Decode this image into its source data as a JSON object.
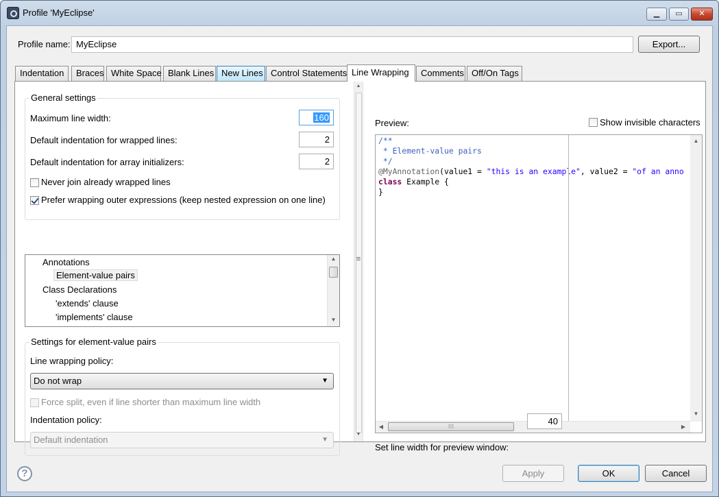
{
  "window": {
    "title": "Profile 'MyEclipse'",
    "minimize_glyph": "▁",
    "maximize_glyph": "▭",
    "close_glyph": "✕"
  },
  "profile": {
    "name_label": "Profile name:",
    "name_value": "MyEclipse",
    "export_label": "Export..."
  },
  "tabs": [
    {
      "label": "Indentation"
    },
    {
      "label": "Braces"
    },
    {
      "label": "White Space"
    },
    {
      "label": "Blank Lines"
    },
    {
      "label": "New Lines"
    },
    {
      "label": "Control Statements"
    },
    {
      "label": "Line Wrapping"
    },
    {
      "label": "Comments"
    },
    {
      "label": "Off/On Tags"
    }
  ],
  "active_tab": "Line Wrapping",
  "general": {
    "title": "General settings",
    "max_width_label": "Maximum line width:",
    "max_width_value": "160",
    "wrapped_indent_label": "Default indentation for wrapped lines:",
    "wrapped_indent_value": "2",
    "array_indent_label": "Default indentation for array initializers:",
    "array_indent_value": "2",
    "never_join_label": "Never join already wrapped lines",
    "never_join_checked": false,
    "prefer_outer_label": "Prefer wrapping outer expressions (keep nested expression on one line)",
    "prefer_outer_checked": true
  },
  "tree": {
    "items": [
      {
        "label": "Annotations"
      },
      {
        "label": "Element-value pairs"
      },
      {
        "label": "Class Declarations"
      },
      {
        "label": "'extends' clause"
      },
      {
        "label": "'implements' clause"
      }
    ],
    "selected": "Element-value pairs"
  },
  "settings": {
    "title": "Settings for element-value pairs",
    "policy_label": "Line wrapping policy:",
    "policy_value": "Do not wrap",
    "force_split_label": "Force split, even if line shorter than maximum line width",
    "force_split_checked": false,
    "indent_policy_label": "Indentation policy:",
    "indent_policy_value": "Default indentation"
  },
  "preview": {
    "label": "Preview:",
    "show_invisible_label": "Show invisible characters",
    "show_invisible_checked": false,
    "code": {
      "l1": "/**",
      "l2": " * Element-value pairs",
      "l3": " */",
      "l4_ann": "@MyAnnotation",
      "l4_mid": "(value1 = ",
      "l4_str1": "\"this is an example\"",
      "l4_mid2": ", value2 = ",
      "l4_str2": "\"of an anno",
      "l5_kw": "class",
      "l5_rest": " Example {",
      "l6": "}"
    },
    "hscroll_grip": "⁝⁝⁝",
    "width_label": "Set line width for preview window:",
    "width_value": "40"
  },
  "footer": {
    "help_glyph": "?",
    "apply_label": "Apply",
    "ok_label": "OK",
    "cancel_label": "Cancel"
  },
  "sash_grip": "≡",
  "colors": {
    "selection": "#3399ff",
    "comment": "#3f5fbf",
    "keyword": "#7f0055",
    "string": "#2a00ff"
  }
}
